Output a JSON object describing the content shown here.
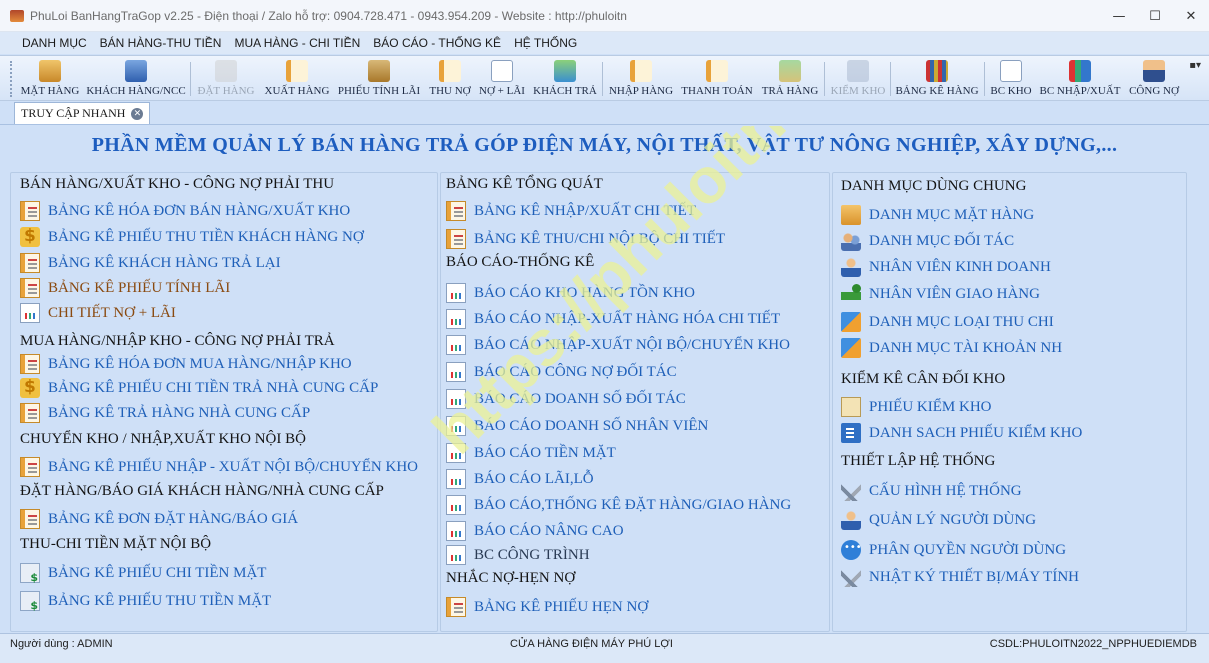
{
  "window": {
    "title": "PhuLoi BanHangTraGop v2.25 - Điện thoại / Zalo hỗ trợ: 0904.728.471 - 0943.954.209 - Website : http://phuloitn",
    "controls": [
      "—",
      "☐",
      "✕"
    ]
  },
  "menu": [
    "DANH MỤC",
    "BÁN HÀNG-THU TIỀN",
    "MUA HÀNG - CHI TIỀN",
    "BÁO CÁO - THỐNG KÊ",
    "HỆ THỐNG"
  ],
  "toolbar": {
    "buttons": [
      {
        "label": "MẶT HÀNG",
        "icon": "boxes-icon",
        "enabled": true
      },
      {
        "label": "KHÁCH HÀNG/NCC",
        "icon": "people-icon",
        "enabled": true
      },
      {
        "label": "ĐẶT HÀNG",
        "icon": "order-icon",
        "enabled": false
      },
      {
        "label": "XUẤT HÀNG",
        "icon": "invoice-icon",
        "enabled": true
      },
      {
        "label": "PHIẾU TÍNH LÃI",
        "icon": "interest-icon",
        "enabled": true
      },
      {
        "label": "THU NỢ",
        "icon": "collect-icon",
        "enabled": true
      },
      {
        "label": "NỢ + LÃI",
        "icon": "debt-icon",
        "enabled": true
      },
      {
        "label": "KHÁCH TRẢ",
        "icon": "return-icon",
        "enabled": true
      },
      {
        "label": "NHẬP HÀNG",
        "icon": "import-icon",
        "enabled": true
      },
      {
        "label": "THANH TOÁN",
        "icon": "payment-icon",
        "enabled": true
      },
      {
        "label": "TRẢ HÀNG",
        "icon": "return-goods-icon",
        "enabled": true
      },
      {
        "label": "KIỂM KHO",
        "icon": "warehouse-icon",
        "enabled": false
      },
      {
        "label": "BẢNG KÊ HÀNG",
        "icon": "binders-icon",
        "enabled": true
      },
      {
        "label": "BC KHO",
        "icon": "report-icon",
        "enabled": true
      },
      {
        "label": "BC NHẬP/XUẤT",
        "icon": "chart-icon",
        "enabled": true
      },
      {
        "label": "CÔNG NỢ",
        "icon": "manager-icon",
        "enabled": true
      }
    ],
    "more": "▪▾"
  },
  "tab": {
    "label": "TRUY CẬP NHANH",
    "close": "✕"
  },
  "headline": "PHẦN MỀM QUẢN LÝ BÁN HÀNG TRẢ GÓP ĐIỆN MÁY, NỘI THẤT, VẬT TƯ NÔNG NGHIỆP, XÂY DỰNG,...",
  "watermark": "https://phuloitn.com",
  "col1": {
    "sections": [
      {
        "title": "BÁN HÀNG/XUẤT KHO - CÔNG NỢ PHẢI THU",
        "items": [
          {
            "label": "BẢNG KÊ HÓA ĐƠN BÁN HÀNG/XUẤT KHO",
            "icon": "doc"
          },
          {
            "label": "BẢNG KÊ PHIẾU THU TIỀN KHÁCH HÀNG NỢ",
            "icon": "dollar"
          },
          {
            "label": "BẢNG KÊ KHÁCH HÀNG TRẢ LẠI",
            "icon": "doc"
          },
          {
            "label": "BẢNG KÊ PHIẾU TÍNH LÃI",
            "icon": "doc"
          },
          {
            "label": "CHI TIẾT NỢ + LÃI",
            "icon": "chart"
          }
        ]
      },
      {
        "title": "MUA HÀNG/NHẬP KHO - CÔNG NỢ PHẢI TRẢ",
        "items": [
          {
            "label": "BẢNG KÊ HÓA ĐƠN MUA HÀNG/NHẬP KHO",
            "icon": "doc"
          },
          {
            "label": "BẢNG KÊ PHIẾU CHI TIỀN TRẢ NHÀ CUNG CẤP",
            "icon": "dollar"
          },
          {
            "label": "BẢNG KÊ TRẢ HÀNG NHÀ CUNG CẤP",
            "icon": "doc"
          }
        ]
      },
      {
        "title": "CHUYỂN KHO / NHẬP,XUẤT KHO NỘI BỘ",
        "items": [
          {
            "label": "BẢNG KÊ PHIẾU NHẬP - XUẤT NỘI BỘ/CHUYỂN KHO",
            "icon": "doc"
          }
        ]
      },
      {
        "title": "ĐẶT HÀNG/BÁO GIÁ KHÁCH HÀNG/NHÀ CUNG CẤP",
        "items": [
          {
            "label": "BẢNG KÊ ĐƠN ĐẶT HÀNG/BÁO GIÁ",
            "icon": "doc"
          }
        ]
      },
      {
        "title": "THU-CHI TIỀN MẶT NỘI BỘ",
        "items": [
          {
            "label": "BẢNG KÊ PHIẾU CHI TIỀN MẶT",
            "icon": "money"
          },
          {
            "label": "BẢNG KÊ PHIẾU THU TIỀN MẶT",
            "icon": "money"
          }
        ]
      }
    ]
  },
  "col2": {
    "sections": [
      {
        "title": "BẢNG KÊ TỔNG QUÁT",
        "items": [
          {
            "label": "BẢNG KÊ NHẬP/XUẤT CHI TIẾT",
            "icon": "doc"
          },
          {
            "label": "BẢNG KÊ THU/CHI NỘI BỘ CHI TIẾT",
            "icon": "doc"
          }
        ]
      },
      {
        "title": "BÁO CÁO-THỐNG KÊ",
        "items": [
          {
            "label": "BÁO CÁO KHO HÀNG TỒN KHO",
            "icon": "chart"
          },
          {
            "label": "BÁO CÁO NHẬP-XUẤT HÀNG HÓA CHI TIẾT",
            "icon": "chart"
          },
          {
            "label": "BÁO CÁO NHẬP-XUẤT NỘI BỘ/CHUYỂN KHO",
            "icon": "chart"
          },
          {
            "label": "BÁO CÁO CÔNG NỢ ĐỐI TÁC",
            "icon": "chart"
          },
          {
            "label": "BÁO CÁO DOANH SỐ ĐỐI TÁC",
            "icon": "chart"
          },
          {
            "label": "BÁO CÁO DOANH SỐ NHÂN VIÊN",
            "icon": "chart"
          },
          {
            "label": "BÁO CÁO TIỀN MẶT",
            "icon": "chart"
          },
          {
            "label": "BÁO CÁO LÃI,LỖ",
            "icon": "chart"
          },
          {
            "label": "BÁO CÁO,THỐNG KÊ ĐẶT HÀNG/GIAO HÀNG",
            "icon": "chart"
          },
          {
            "label": "BÁO CÁO NÂNG CAO",
            "icon": "chart"
          },
          {
            "label": "BC CÔNG TRÌNH",
            "icon": "chart"
          }
        ]
      },
      {
        "title": "NHẮC NỢ-HẸN NỢ",
        "items": [
          {
            "label": "BẢNG KÊ PHIẾU HẸN NỢ",
            "icon": "doc"
          }
        ]
      }
    ]
  },
  "col3": {
    "sections": [
      {
        "title": "DANH MỤC DÙNG CHUNG",
        "items": [
          {
            "label": "DANH MỤC MẶT HÀNG",
            "icon": "box"
          },
          {
            "label": "DANH MỤC ĐỐI TÁC",
            "icon": "people"
          },
          {
            "label": "NHÂN VIÊN KINH DOANH",
            "icon": "user"
          },
          {
            "label": "NHÂN VIÊN GIAO HÀNG",
            "icon": "truck"
          },
          {
            "label": "DANH MỤC LOẠI THU CHI",
            "icon": "cubes"
          },
          {
            "label": "DANH MỤC TÀI KHOẢN NH",
            "icon": "cubes"
          }
        ]
      },
      {
        "title": "KIỂM KÊ CÂN ĐỐI KHO",
        "items": [
          {
            "label": "PHIẾU KIỂM KHO",
            "icon": "clip"
          },
          {
            "label": "DANH SACH PHIẾU KIỂM KHO",
            "icon": "building"
          }
        ]
      },
      {
        "title": "THIẾT LẬP HỆ THỐNG",
        "items": [
          {
            "label": "CẤU HÌNH HỆ THỐNG",
            "icon": "tools"
          },
          {
            "label": "QUẢN LÝ NGƯỜI DÙNG",
            "icon": "user"
          },
          {
            "label": "PHÂN QUYỀN NGƯỜI DÙNG",
            "icon": "dots"
          },
          {
            "label": "NHẬT KÝ THIẾT BỊ/MÁY TÍNH",
            "icon": "tools"
          }
        ]
      }
    ]
  },
  "status": {
    "user": "Người dùng : ADMIN",
    "store": "CỬA HÀNG ĐIỆN MÁY PHÚ LỢI",
    "db": "CSDL:PHULOITN2022_NPPHUEDIEMDB"
  },
  "colors": {
    "link": "#1e5fb8",
    "headline": "#1d5dbf",
    "background": "#cfe0f7",
    "watermark": "#ebf296"
  }
}
